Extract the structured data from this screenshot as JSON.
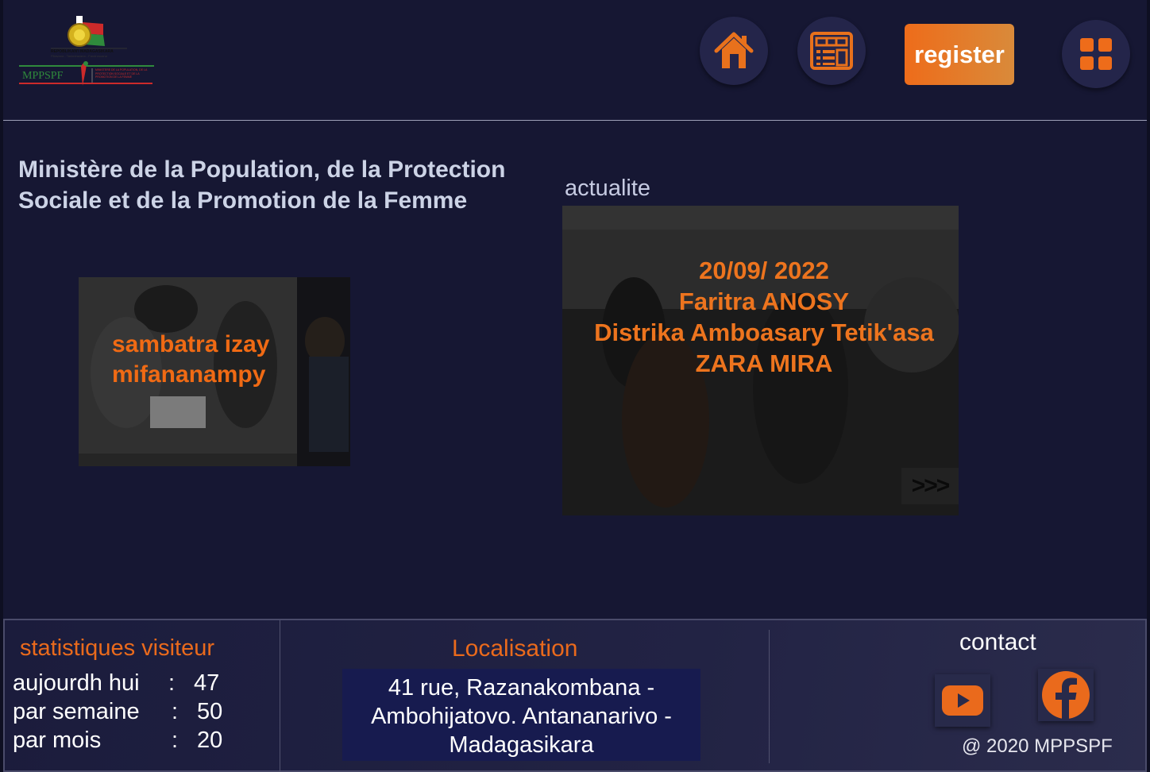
{
  "header": {
    "logo_country": "REPOBLIKAN'I MADAGASIKARA",
    "logo_motto": "Fitiavana - Tanindrazana - Fandrosoana",
    "logo_acronym": "MPPSPF",
    "logo_ministry": "MINISTERE DE LA POPULATION, DE LA PROTECTION SOCIALE ET DE LA PROMOTION DE LA FEMME",
    "nav": [
      {
        "icon": "home-icon"
      },
      {
        "icon": "news-icon"
      }
    ],
    "register_label": "register",
    "menu_icon": "grid-menu-icon"
  },
  "main": {
    "title": "Ministère de la Population, de la Protection Sociale et de la Promotion de la Femme",
    "promo_line1": "sambatra izay",
    "promo_line2": "mifananampy",
    "news_section_label": "actualite",
    "news_lines": [
      "20/09/ 2022",
      "Faritra ANOSY",
      "Distrika Amboasary Tetik'asa",
      "ZARA MIRA"
    ],
    "news_next": ">>>"
  },
  "footer": {
    "stats_title": "statistiques visiteur",
    "stats": [
      {
        "label": "aujourdh hui",
        "sep": ":",
        "value": "47"
      },
      {
        "label": "par semaine",
        "sep": ":",
        "value": "50"
      },
      {
        "label": "par mois",
        "sep": ":",
        "value": "20"
      }
    ],
    "location_title": "Localisation",
    "address_lines": [
      "41 rue, Razanakombana -",
      "Ambohijatovo. Antananarivo -",
      "Madagasikara"
    ],
    "contact_title": "contact",
    "social": [
      {
        "icon": "youtube-icon"
      },
      {
        "icon": "facebook-icon"
      }
    ],
    "copyright": "@ 2020 MPPSPF"
  },
  "colors": {
    "background": "#161733",
    "accent": "#ee6c1a",
    "title_text": "#ccd3e6",
    "address_bg": "#171b4f"
  }
}
